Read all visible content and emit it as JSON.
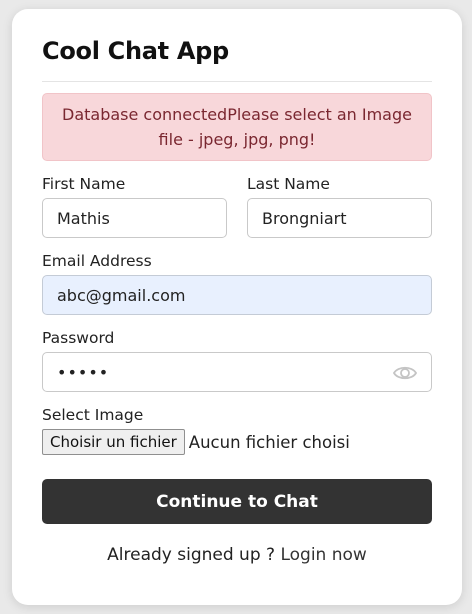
{
  "app": {
    "title": "Cool Chat App"
  },
  "alert": {
    "message": "Database connectedPlease select an Image file - jpeg, jpg, png!"
  },
  "form": {
    "first_name_label": "First Name",
    "first_name_value": "Mathis",
    "last_name_label": "Last Name",
    "last_name_value": "Brongniart",
    "email_label": "Email Address",
    "email_value": "abc@gmail.com",
    "password_label": "Password",
    "password_display": "•••••",
    "image_label": "Select Image",
    "file_button_label": "Choisir un fichier",
    "file_status": "Aucun fichier choisi",
    "submit_label": "Continue to Chat"
  },
  "footer": {
    "prompt": "Already signed up ?",
    "link_label": "Login now"
  },
  "colors": {
    "button_bg": "#333333",
    "alert_bg": "#f8d7da",
    "alert_text": "#7a2730",
    "autofill_bg": "#e8f0fe"
  },
  "icons": {
    "password_toggle": "eye-icon"
  }
}
